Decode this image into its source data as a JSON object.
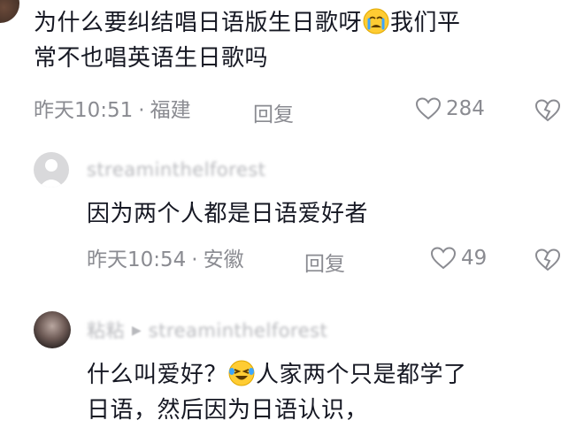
{
  "comment1": {
    "text_line1_a": "为什么要纠结唱日语版生日歌呀",
    "emoji": "crying-face-emoji",
    "text_line1_b": "我们平",
    "text_line2": "常不也唱英语生日歌吗",
    "time": "昨天10:51",
    "location": "福建",
    "reply_label": "回复",
    "like_count": "284"
  },
  "reply1": {
    "username": "streaminthelforest",
    "text": "因为两个人都是日语爱好者",
    "time": "昨天10:54",
    "location": "安徽",
    "reply_label": "回复",
    "like_count": "49"
  },
  "reply2": {
    "username": "粘粘",
    "reply_to": "streaminthelforest",
    "text_line1_a": "什么叫爱好？",
    "emoji": "laughing-tears-emoji",
    "text_line1_b": "人家两个只是都学了",
    "text_line2": "日语，然后因为日语认识，"
  },
  "colors": {
    "text": "#161823",
    "meta": "#8a8b91",
    "username": "#b8b9bd"
  },
  "separator": "·"
}
